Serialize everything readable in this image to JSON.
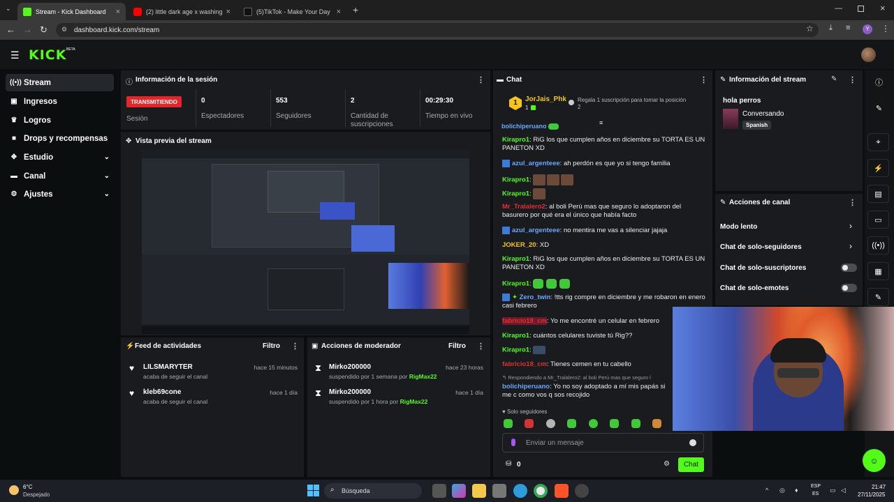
{
  "browser": {
    "tabs": [
      {
        "title": "Stream - Kick Dashboard",
        "active": true,
        "favicon_color": "#53fc18"
      },
      {
        "title": "(2) little dark age x washing ma",
        "active": false,
        "favicon_color": "#ff0000"
      },
      {
        "title": "(5)TikTok - Make Your Day",
        "active": false,
        "favicon_color": "#000000"
      }
    ],
    "new_tab": "+",
    "url": "dashboard.kick.com/stream",
    "profile_initial": "Y"
  },
  "kick": {
    "logo": "KICK",
    "beta": "BETA",
    "accent": "#53fc18"
  },
  "sidebar": {
    "items": [
      {
        "label": "Stream",
        "icon": "stream-icon",
        "selected": true
      },
      {
        "label": "Ingresos",
        "icon": "money-icon"
      },
      {
        "label": "Logros",
        "icon": "trophy-icon"
      },
      {
        "label": "Drops y recompensas",
        "icon": "gift-icon"
      },
      {
        "label": "Estudio",
        "icon": "studio-icon",
        "expandable": true
      },
      {
        "label": "Canal",
        "icon": "channel-icon",
        "expandable": true
      },
      {
        "label": "Ajustes",
        "icon": "settings-icon",
        "expandable": true
      }
    ]
  },
  "session": {
    "title": "Información de la sesión",
    "status": "TRANSMITIENDO",
    "status_label": "Sesión",
    "stats": [
      {
        "value": "0",
        "label": "Espectadores"
      },
      {
        "value": "553",
        "label": "Seguidores"
      },
      {
        "value": "2",
        "label": "Cantidad de suscripciones"
      },
      {
        "value": "00:29:30",
        "label": "Tiempo en vivo"
      }
    ]
  },
  "preview": {
    "title": "Vista previa del stream"
  },
  "feed": {
    "title": "Feed de actividades",
    "filter": "Filtro",
    "items": [
      {
        "name": "LILSMARYTER",
        "sub": "acaba de seguir el canal",
        "time": "hace 15 minutos"
      },
      {
        "name": "kleb69cone",
        "sub": "acaba de seguir el canal",
        "time": "hace 1 día"
      }
    ]
  },
  "mod": {
    "title": "Acciones de moderador",
    "filter": "Filtro",
    "items": [
      {
        "name": "Mirko200000",
        "sub": "suspendido por 1 semana por",
        "by": "RigMax22",
        "time": "hace 23 horas"
      },
      {
        "name": "Mirko200000",
        "sub": "suspendido por 1 hora por",
        "by": "RigMax22",
        "time": "hace 1 día"
      }
    ]
  },
  "chat": {
    "title": "Chat",
    "pinned_user": "JorJais_Phk",
    "pinned_count": "1",
    "pinned_rank": "1",
    "gift_text": "Regala 1 suscripción para tomar la posición",
    "gift_pos": "2",
    "partial_user": "bolichiperuano",
    "messages": [
      {
        "user": "Kirapro1",
        "color": "#53fc18",
        "text": "RiG los que cumplen años en diciembre su TORTA ES UN PANETON XD"
      },
      {
        "user": "azul_argenteee",
        "color": "#6aa8ff",
        "text": "ah perdón es que yo si tengo familia"
      },
      {
        "user": "Kirapro1",
        "color": "#53fc18",
        "text": ""
      },
      {
        "user": "Kirapro1",
        "color": "#53fc18",
        "text": ""
      },
      {
        "user": "Mr_Tralalero2",
        "color": "#e03131",
        "text": "al boli Perú mas que seguro lo adoptaron del basurero por qué era el único que había facto"
      },
      {
        "user": "azul_argenteee",
        "color": "#6aa8ff",
        "text": "no mentira me vas a silenciar jajaja"
      },
      {
        "user": "JOKER_20",
        "color": "#f5c518",
        "text": "XD"
      },
      {
        "user": "Kirapro1",
        "color": "#53fc18",
        "text": "RiG los que cumplen años en diciembre su TORTA ES UN PANETON XD"
      },
      {
        "user": "Kirapro1",
        "color": "#53fc18",
        "text": ""
      },
      {
        "user": "Zero_twin",
        "color": "#6aa8ff",
        "text": "!tts rig compre en diciembre y me robaron en enero casi febrero"
      },
      {
        "user": "fabricio18_cm",
        "color": "#e03131",
        "text": "Yo me encontré un celular en febrero"
      },
      {
        "user": "Kirapro1",
        "color": "#53fc18",
        "text": "cuántos celulares tuviste tú Rig??"
      },
      {
        "user": "Kirapro1",
        "color": "#53fc18",
        "text": ""
      },
      {
        "user": "fabricio18_cm",
        "color": "#e03131",
        "text": "Tienes cemen en tu cabello"
      },
      {
        "user": "bolichiperuano",
        "color": "#6aa8ff",
        "text": "Yo no soy adoptado a mí mis papás si me c como vos q sos recojido"
      }
    ],
    "reply_to": "Respondiendo a Mr_Tralalero2: al boli Perú mas que seguro l",
    "followers_only": "Solo seguidores",
    "placeholder": "Enviar un mensaje",
    "points": "0",
    "send": "Chat"
  },
  "streaminfo": {
    "title": "Información del stream",
    "stream_title": "hola perros",
    "category": "Conversando",
    "language": "Spanish"
  },
  "canal": {
    "title": "Acciones de canal",
    "rows": [
      {
        "label": "Modo lento",
        "control": "chevron"
      },
      {
        "label": "Chat de solo-seguidores",
        "control": "chevron"
      },
      {
        "label": "Chat de solo-suscriptores",
        "control": "toggle"
      },
      {
        "label": "Chat de solo-emotes",
        "control": "toggle"
      }
    ]
  },
  "taskbar": {
    "weather_temp": "6°C",
    "weather_desc": "Despejado",
    "search": "Búsqueda",
    "lang1": "ESP",
    "lang2": "ES",
    "time": "21:47",
    "date": "27/11/2025"
  }
}
